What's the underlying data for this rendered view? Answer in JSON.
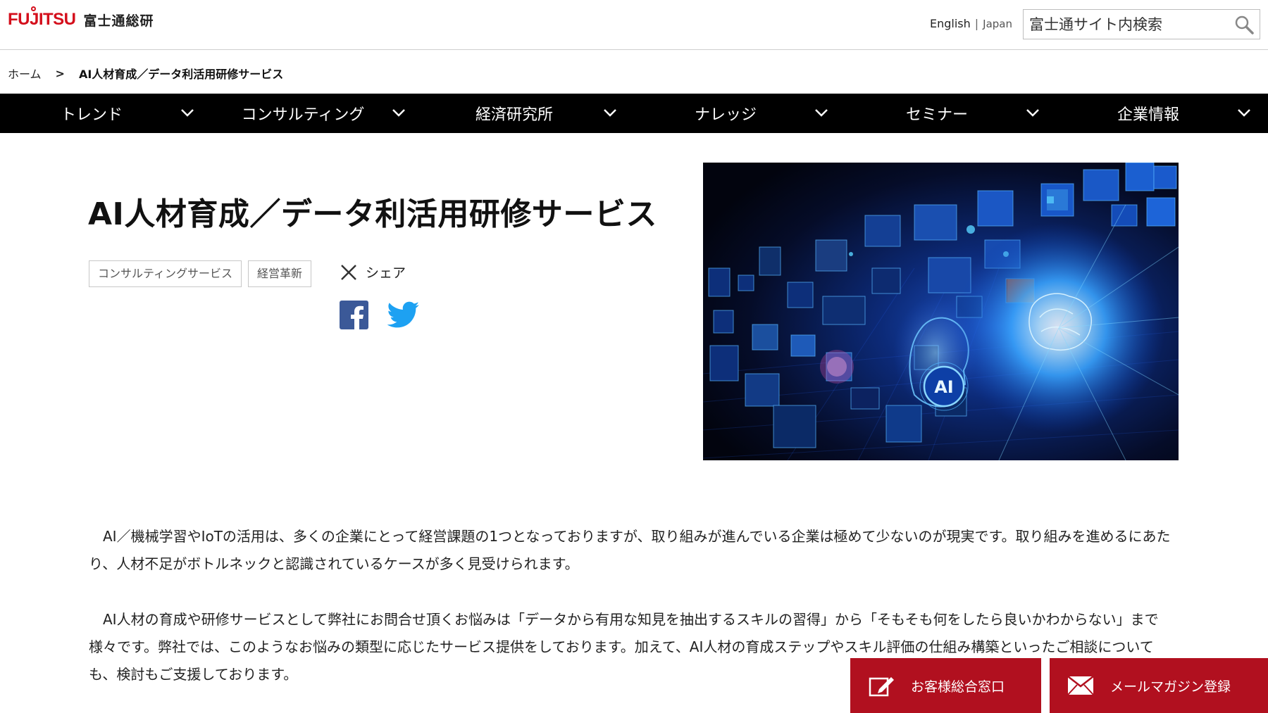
{
  "header": {
    "logo_brand": "FUJITSU",
    "logo_company": "富士通総研",
    "lang_english": "English",
    "lang_separator": "|",
    "lang_japan": "Japan",
    "search_placeholder": "富士通サイト内検索"
  },
  "breadcrumb": {
    "home": "ホーム",
    "separator": ">",
    "current": "AI人材育成／データ利活用研修サービス"
  },
  "nav": {
    "items": [
      {
        "label": "トレンド"
      },
      {
        "label": "コンサルティング"
      },
      {
        "label": "経済研究所"
      },
      {
        "label": "ナレッジ"
      },
      {
        "label": "セミナー"
      },
      {
        "label": "企業情報"
      }
    ]
  },
  "main": {
    "title": "AI人材育成／データ利活用研修サービス",
    "tags": [
      "コンサルティングサービス",
      "経営革新"
    ],
    "share_label": "シェア",
    "paragraphs": [
      "　AI／機械学習やIoTの活用は、多くの企業にとって経営課題の1つとなっておりますが、取り組みが進んでいる企業は極めて少ないのが現実です。取り組みを進めるにあたり、人材不足がボトルネックと認識されているケースが多く見受けられます。",
      "　AI人材の育成や研修サービスとして弊社にお問合せ頂くお悩みは「データから有用な知見を抽出するスキルの習得」から「そもそも何をしたら良いかわからない」まで様々です。弊社では、このようなお悩みの類型に応じたサービス提供をしております。加えて、AI人材の育成ステップやスキル評価の仕組み構築といったご相談についても、検討もご支援しております。"
    ],
    "hero_label": "AI"
  },
  "cta": {
    "contact_label": "お客様総合窓口",
    "mail_label": "メールマガジン登録"
  },
  "colors": {
    "brand_red": "#d40f1c",
    "cta_red": "#b1101f",
    "nav_bg": "#000000",
    "facebook": "#3b5998",
    "twitter": "#1da1f2"
  }
}
